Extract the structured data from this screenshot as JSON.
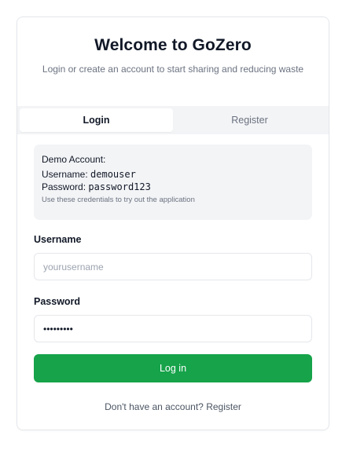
{
  "header": {
    "title": "Welcome to GoZero",
    "subtitle": "Login or create an account to start sharing and reducing waste"
  },
  "tabs": [
    {
      "label": "Login",
      "active": true
    },
    {
      "label": "Register",
      "active": false
    }
  ],
  "demo": {
    "title": "Demo Account:",
    "username_label": "Username:",
    "username_value": "demouser",
    "password_label": "Password:",
    "password_value": "password123",
    "note": "Use these credentials to try out the application"
  },
  "form": {
    "username_label": "Username",
    "username_placeholder": "yourusername",
    "password_label": "Password",
    "password_value": "•••••••••",
    "submit_label": "Log in"
  },
  "footer": {
    "text": "Don't have an account?",
    "link": "Register"
  },
  "colors": {
    "accent": "#16a34a",
    "muted_bg": "#f3f4f6",
    "border": "#e5e7eb"
  }
}
